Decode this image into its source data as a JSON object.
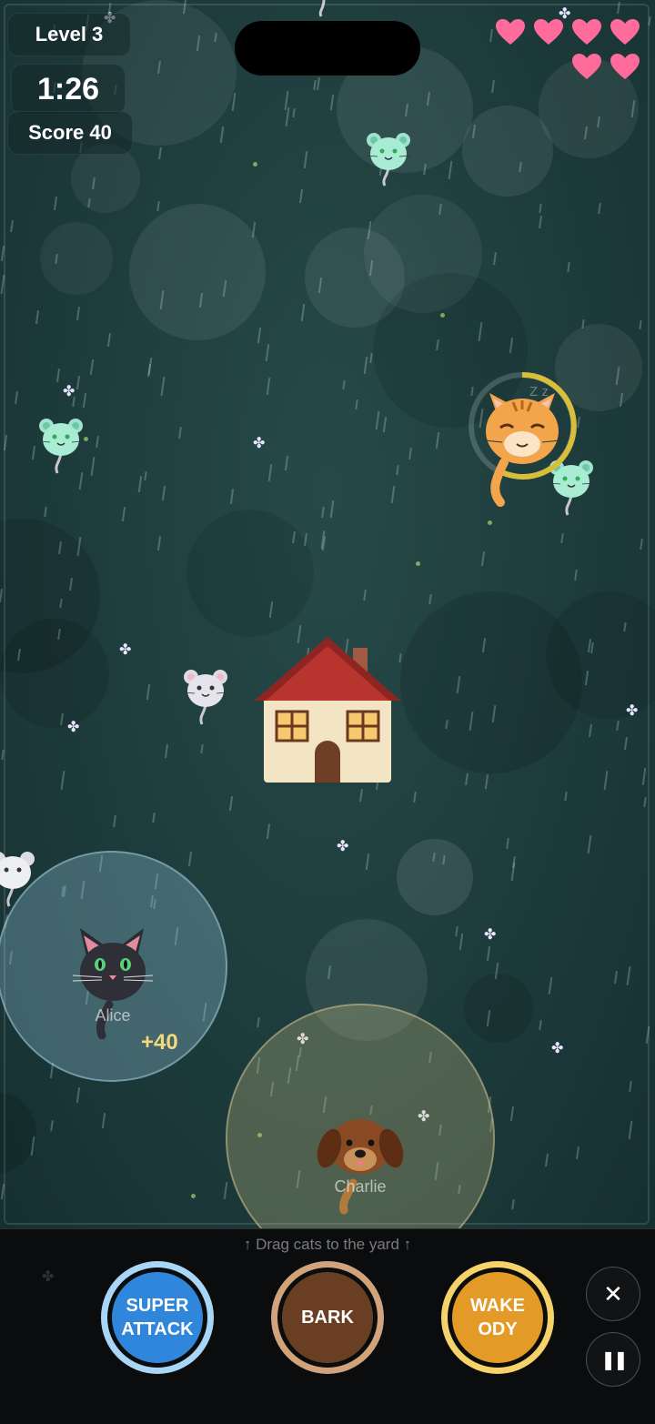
{
  "hud": {
    "level": "Level 3",
    "timer": "1:26",
    "score": "Score 40",
    "lives": 6
  },
  "characters": {
    "alice": "Alice",
    "charlie": "Charlie",
    "sleeping_cat_label": "Z z"
  },
  "floating_text": {
    "bonus": "+40"
  },
  "hint": "↑  Drag cats to the yard  ↑",
  "abilities": {
    "super_attack": "SUPER ATTACK",
    "bark": "BARK",
    "wake": "WAKE ODY"
  },
  "buttons": {
    "close": "✕",
    "pause": "❚❚"
  },
  "colors": {
    "heart": "#ff6b9a",
    "super_attack": "#2f86db",
    "bark": "#6a3e22",
    "wake": "#e39a26"
  }
}
